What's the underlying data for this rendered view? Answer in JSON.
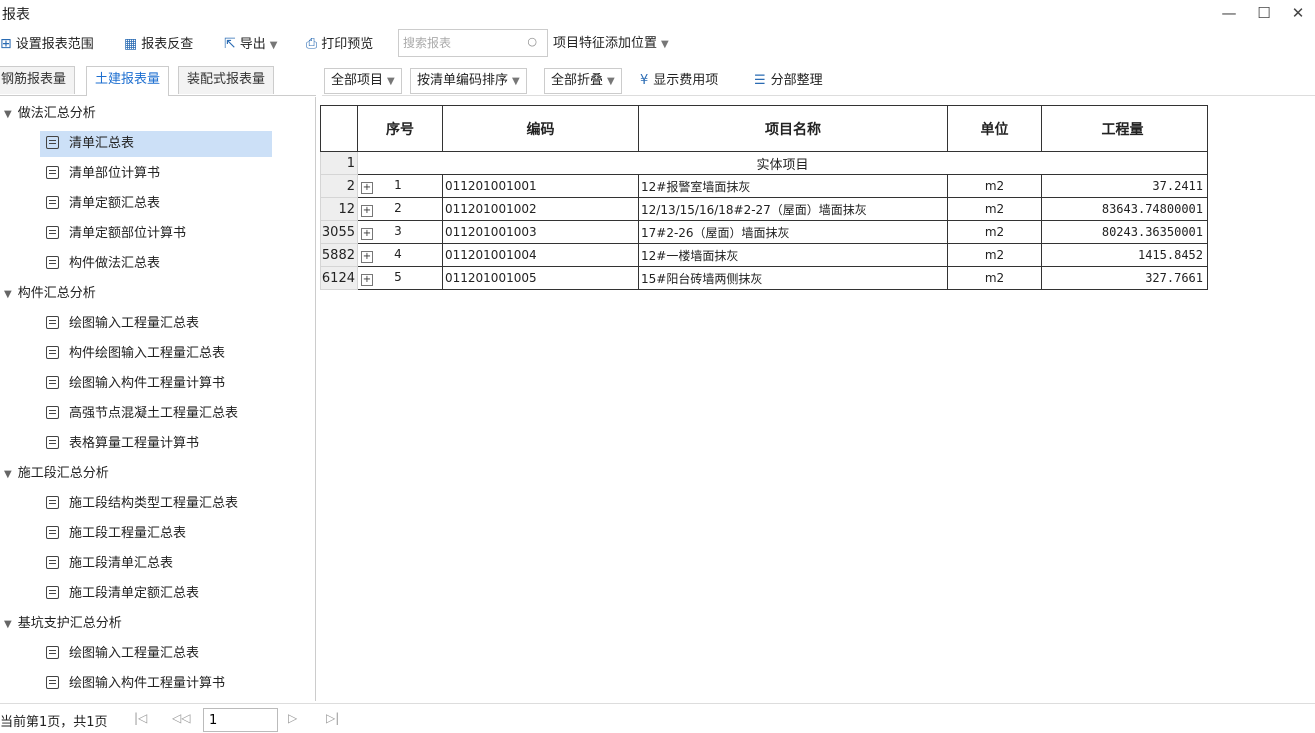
{
  "window": {
    "title": "报表",
    "minimize": "—",
    "maximize": "☐",
    "close": "✕"
  },
  "toolbar": {
    "set_range": "设置报表范围",
    "reverse": "报表反查",
    "export": "导出",
    "print_preview": "打印预览",
    "search_placeholder": "搜索报表",
    "feature_position": "项目特征添加位置"
  },
  "tabs": [
    {
      "label": "钢筋报表量",
      "active": false
    },
    {
      "label": "土建报表量",
      "active": true
    },
    {
      "label": "装配式报表量",
      "active": false
    }
  ],
  "tree": {
    "groups": [
      {
        "label": "做法汇总分析",
        "items": [
          "清单汇总表",
          "清单部位计算书",
          "清单定额汇总表",
          "清单定额部位计算书",
          "构件做法汇总表"
        ]
      },
      {
        "label": "构件汇总分析",
        "items": [
          "绘图输入工程量汇总表",
          "构件绘图输入工程量汇总表",
          "绘图输入构件工程量计算书",
          "高强节点混凝土工程量汇总表",
          "表格算量工程量计算书"
        ]
      },
      {
        "label": "施工段汇总分析",
        "items": [
          "施工段结构类型工程量汇总表",
          "施工段工程量汇总表",
          "施工段清单汇总表",
          "施工段清单定额汇总表"
        ]
      },
      {
        "label": "基坑支护汇总分析",
        "items": [
          "绘图输入工程量汇总表",
          "绘图输入构件工程量计算书"
        ]
      }
    ],
    "selected": "清单汇总表"
  },
  "right_toolbar": {
    "all_items": "全部项目",
    "sort": "按清单编码排序",
    "fold": "全部折叠",
    "show_fee": "显示费用项",
    "partition": "分部整理"
  },
  "grid": {
    "headers": {
      "seq": "序号",
      "code": "编码",
      "name": "项目名称",
      "unit": "单位",
      "qty": "工程量"
    },
    "section_row": {
      "row": "1",
      "label": "实体项目"
    },
    "rows": [
      {
        "row": "2",
        "seq": "1",
        "code": "011201001001",
        "name": "12#报警室墙面抹灰",
        "unit": "m2",
        "qty": "37.2411"
      },
      {
        "row": "12",
        "seq": "2",
        "code": "011201001002",
        "name": "12/13/15/16/18#2-27（屋面）墙面抹灰",
        "unit": "m2",
        "qty": "83643.74800001"
      },
      {
        "row": "3055",
        "seq": "3",
        "code": "011201001003",
        "name": "17#2-26（屋面）墙面抹灰",
        "unit": "m2",
        "qty": "80243.36350001"
      },
      {
        "row": "5882",
        "seq": "4",
        "code": "011201001004",
        "name": "12#一楼墙面抹灰",
        "unit": "m2",
        "qty": "1415.8452"
      },
      {
        "row": "6124",
        "seq": "5",
        "code": "011201001005",
        "name": "15#阳台砖墙两侧抹灰",
        "unit": "m2",
        "qty": "327.7661"
      }
    ]
  },
  "status": {
    "page_info": "当前第1页，共1页",
    "page_value": "1"
  }
}
